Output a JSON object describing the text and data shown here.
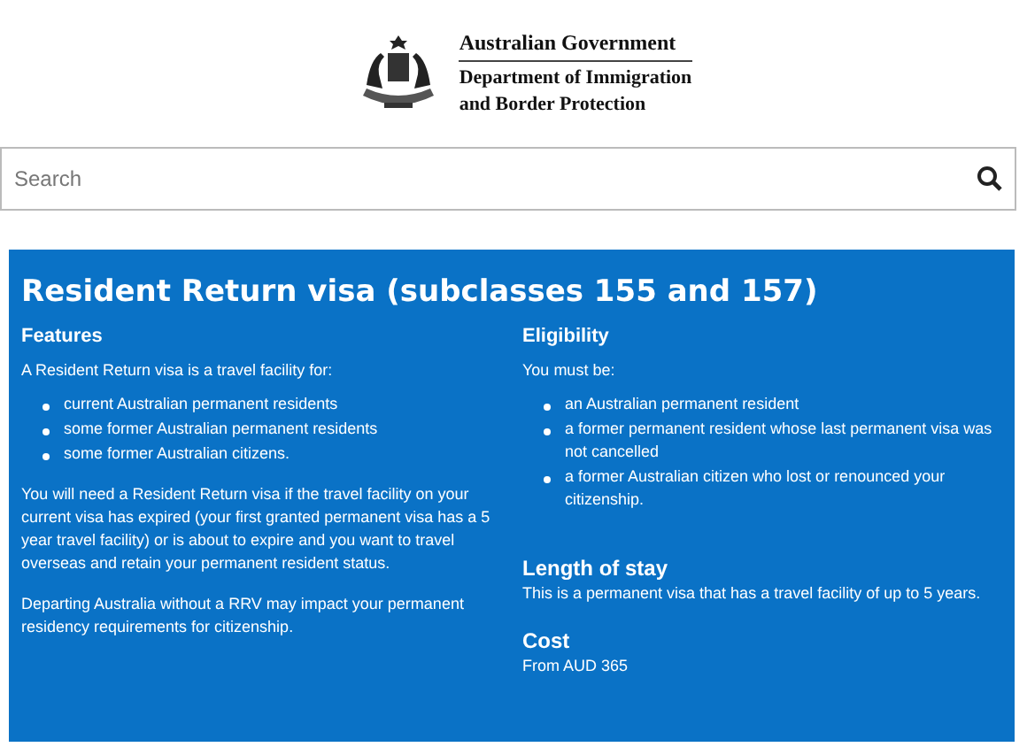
{
  "header": {
    "government": "Australian Government",
    "department_line_1": "Department of Immigration",
    "department_line_2": "and Border Protection"
  },
  "search": {
    "placeholder": "Search"
  },
  "panel": {
    "title": "Resident Return visa (subclasses 155 and 157)",
    "features": {
      "heading": "Features",
      "intro": "A Resident Return visa is a travel facility for:",
      "items": [
        "current Australian permanent residents",
        "some former Australian permanent residents",
        "some former Australian citizens."
      ],
      "paragraphs": [
        "You will need a Resident Return visa if the travel facility on your current visa has expired (your first granted permanent visa has a 5 year travel facility) or is about to expire and you want to travel overseas and retain your permanent resident status.",
        "Departing Australia without a RRV may impact your permanent residency requirements for citizenship."
      ]
    },
    "eligibility": {
      "heading": "Eligibility",
      "intro": "You must be:",
      "items": [
        "an Australian permanent resident",
        "a former permanent resident whose last permanent visa was not cancelled",
        "a former Australian citizen who lost or renounced your citizenship."
      ]
    },
    "sections": [
      {
        "heading": "Length of stay",
        "text": "This is a permanent visa that has a travel facility of up to 5 years."
      },
      {
        "heading": "Cost",
        "text": "From AUD 365"
      }
    ]
  }
}
